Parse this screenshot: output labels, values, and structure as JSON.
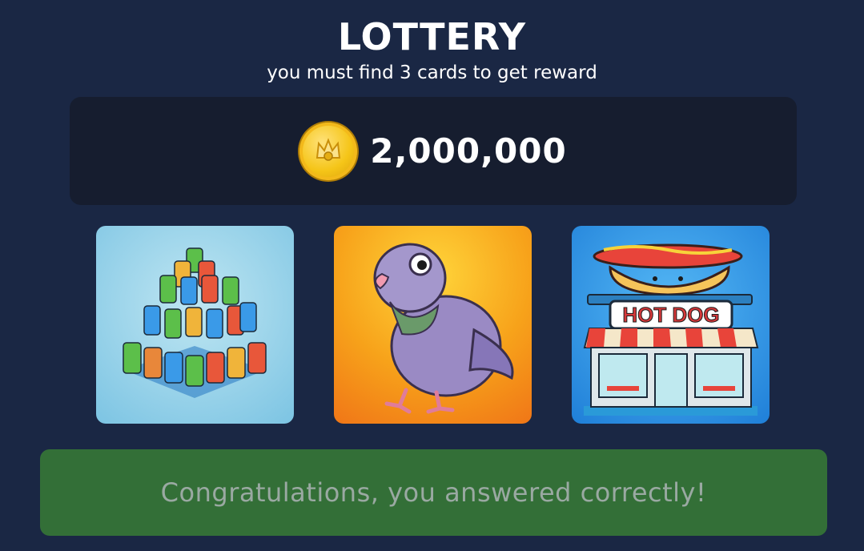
{
  "header": {
    "title": "LOTTERY",
    "subtitle": "you must find 3 cards to get reward"
  },
  "reward": {
    "icon": "gold-coin-icon",
    "amount": "2,000,000"
  },
  "cards": [
    {
      "name": "soda-cans-pyramid",
      "icon": "soda-cans-icon"
    },
    {
      "name": "pigeon",
      "icon": "pigeon-icon"
    },
    {
      "name": "hot-dog-stand",
      "icon": "hot-dog-stand-icon",
      "sign_text": "HOT DOG"
    }
  ],
  "result": {
    "message": "Congratulations, you answered correctly!",
    "status": "correct",
    "color": "#336f37"
  },
  "colors": {
    "background": "#1a2744",
    "panel": "#161d2f",
    "coin": "#f5c518"
  }
}
